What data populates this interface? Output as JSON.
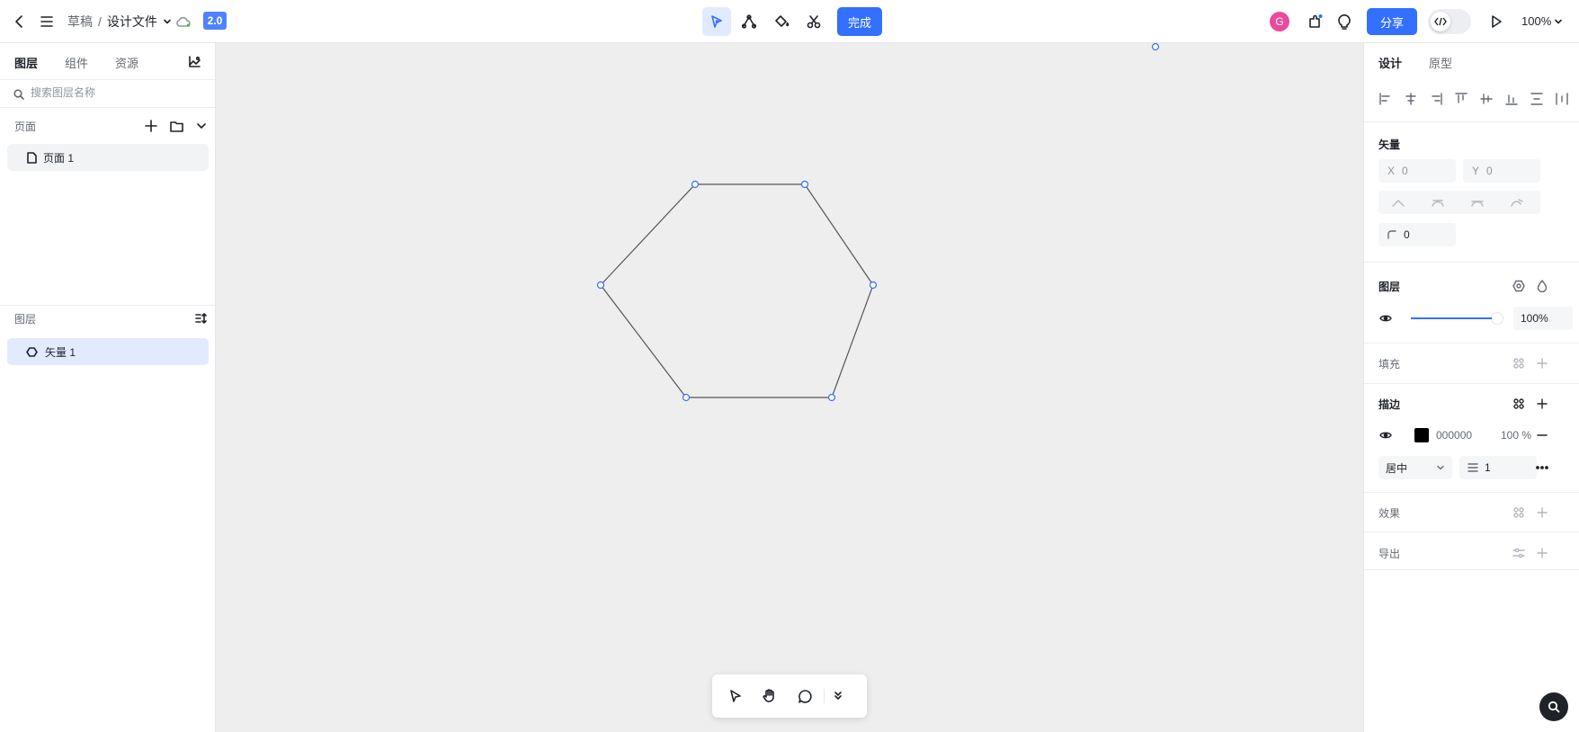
{
  "header": {
    "breadcrumb_root": "草稿",
    "breadcrumb_sep": "/",
    "file_name": "设计文件",
    "version": "2.0",
    "done_label": "完成",
    "avatar_letter": "G",
    "share_label": "分享",
    "zoom": "100%"
  },
  "left": {
    "tabs": [
      "图层",
      "组件",
      "资源"
    ],
    "search_placeholder": "搜索图层名称",
    "pages_title": "页面",
    "pages": [
      "页面 1"
    ],
    "layers_title": "图层",
    "layers": [
      "矢量 1"
    ]
  },
  "right": {
    "tabs": [
      "设计",
      "原型"
    ],
    "vector_title": "矢量",
    "x_label": "X",
    "x_value": "0",
    "y_label": "Y",
    "y_value": "0",
    "radius_value": "0",
    "layer_title": "图层",
    "opacity": "100%",
    "fill_title": "填充",
    "stroke_title": "描边",
    "stroke_color": "000000",
    "stroke_opacity": "100 %",
    "stroke_align": "居中",
    "stroke_width": "1",
    "effects_title": "效果",
    "export_title": "导出"
  },
  "colors": {
    "accent": "#3370ff",
    "version_badge": "#4e83fd",
    "avatar": "#eb4a9c",
    "canvas": "#eeeeee",
    "stroke": "#000000"
  }
}
